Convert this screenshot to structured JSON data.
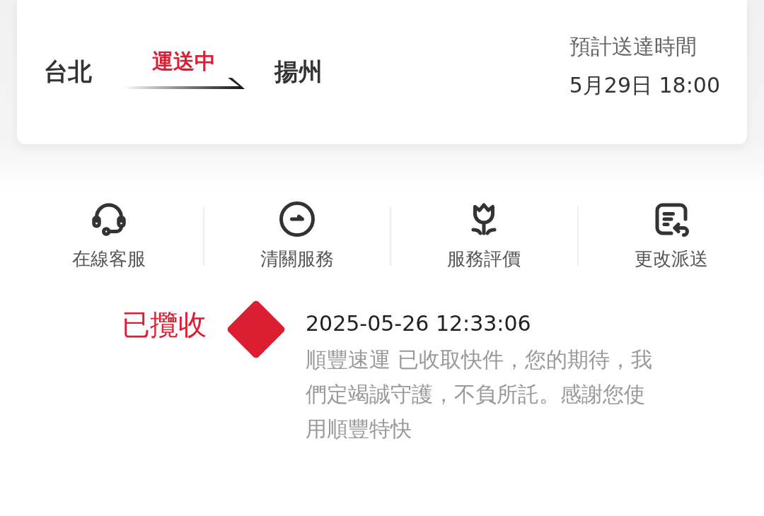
{
  "shipment": {
    "origin": "台北",
    "status": "運送中",
    "destination": "揚州",
    "eta_label": "預計送達時間",
    "eta": "5月29日 18:00"
  },
  "actions": [
    {
      "kind": "headset",
      "label": "在線客服"
    },
    {
      "kind": "clearance",
      "label": "清關服務"
    },
    {
      "kind": "flower",
      "label": "服務評價"
    },
    {
      "kind": "reroute",
      "label": "更改派送"
    }
  ],
  "timeline": [
    {
      "status": "已攬收",
      "time": "2025-05-26 12:33:06",
      "detail": "順豐速運 已收取快件，您的期待，我們定竭誠守護，不負所託。感謝您使用順豐特快",
      "color": "#dc1e32"
    }
  ]
}
